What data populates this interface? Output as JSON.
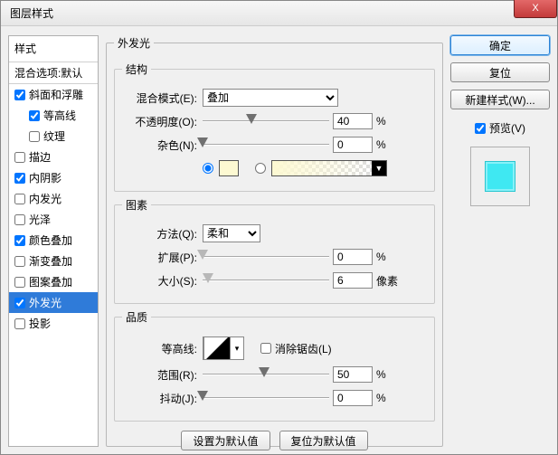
{
  "window": {
    "title": "图层样式"
  },
  "close_x": "X",
  "styles": {
    "header": "样式",
    "default": "混合选项:默认",
    "items": [
      {
        "label": "斜面和浮雕",
        "checked": true,
        "sub": false
      },
      {
        "label": "等高线",
        "checked": true,
        "sub": true
      },
      {
        "label": "纹理",
        "checked": false,
        "sub": true
      },
      {
        "label": "描边",
        "checked": false,
        "sub": false
      },
      {
        "label": "内阴影",
        "checked": true,
        "sub": false
      },
      {
        "label": "内发光",
        "checked": false,
        "sub": false
      },
      {
        "label": "光泽",
        "checked": false,
        "sub": false
      },
      {
        "label": "颜色叠加",
        "checked": true,
        "sub": false
      },
      {
        "label": "渐变叠加",
        "checked": false,
        "sub": false
      },
      {
        "label": "图案叠加",
        "checked": false,
        "sub": false
      },
      {
        "label": "外发光",
        "checked": true,
        "sub": false,
        "selected": true
      },
      {
        "label": "投影",
        "checked": false,
        "sub": false
      }
    ]
  },
  "panel": {
    "title": "外发光",
    "struct": {
      "legend": "结构",
      "blend_label": "混合模式(E):",
      "blend_value": "叠加",
      "opacity_label": "不透明度(O):",
      "opacity_value": "40",
      "opacity_unit": "%",
      "noise_label": "杂色(N):",
      "noise_value": "0",
      "noise_unit": "%",
      "use_color": true,
      "swatch_color": "#fdf9d2"
    },
    "elem": {
      "legend": "图素",
      "method_label": "方法(Q):",
      "method_value": "柔和",
      "spread_label": "扩展(P):",
      "spread_value": "0",
      "spread_unit": "%",
      "size_label": "大小(S):",
      "size_value": "6",
      "size_unit": "像素"
    },
    "qual": {
      "legend": "品质",
      "contour_label": "等高线:",
      "aa_label": "消除锯齿(L)",
      "aa_checked": false,
      "range_label": "范围(R):",
      "range_value": "50",
      "range_unit": "%",
      "jitter_label": "抖动(J):",
      "jitter_value": "0",
      "jitter_unit": "%"
    },
    "set_default": "设置为默认值",
    "reset_default": "复位为默认值"
  },
  "right": {
    "ok": "确定",
    "cancel": "复位",
    "newstyle": "新建样式(W)...",
    "preview_label": "预览(V)",
    "preview_checked": true
  }
}
